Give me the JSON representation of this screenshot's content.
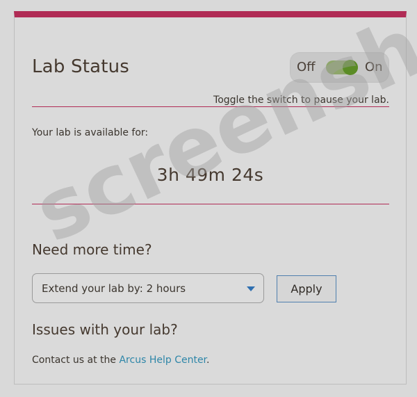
{
  "lab_status": {
    "title": "Lab Status",
    "toggle": {
      "off_label": "Off",
      "on_label": "On",
      "state": "on"
    },
    "hint": "Toggle the switch to pause your lab."
  },
  "availability": {
    "label": "Your lab is available for:",
    "time_remaining": "3h 49m 24s"
  },
  "more_time": {
    "heading": "Need more time?",
    "select_prefix": "Extend your lab by:",
    "select_value": "2 hours",
    "apply_label": "Apply"
  },
  "issues": {
    "heading": "Issues with your lab?",
    "contact_prefix": "Contact us at the ",
    "link_text": "Arcus Help Center",
    "contact_suffix": "."
  },
  "watermark": "screenshot",
  "colors": {
    "accent": "#b02b55",
    "toggle_on": "#5b8c26",
    "link": "#2e86a8"
  }
}
